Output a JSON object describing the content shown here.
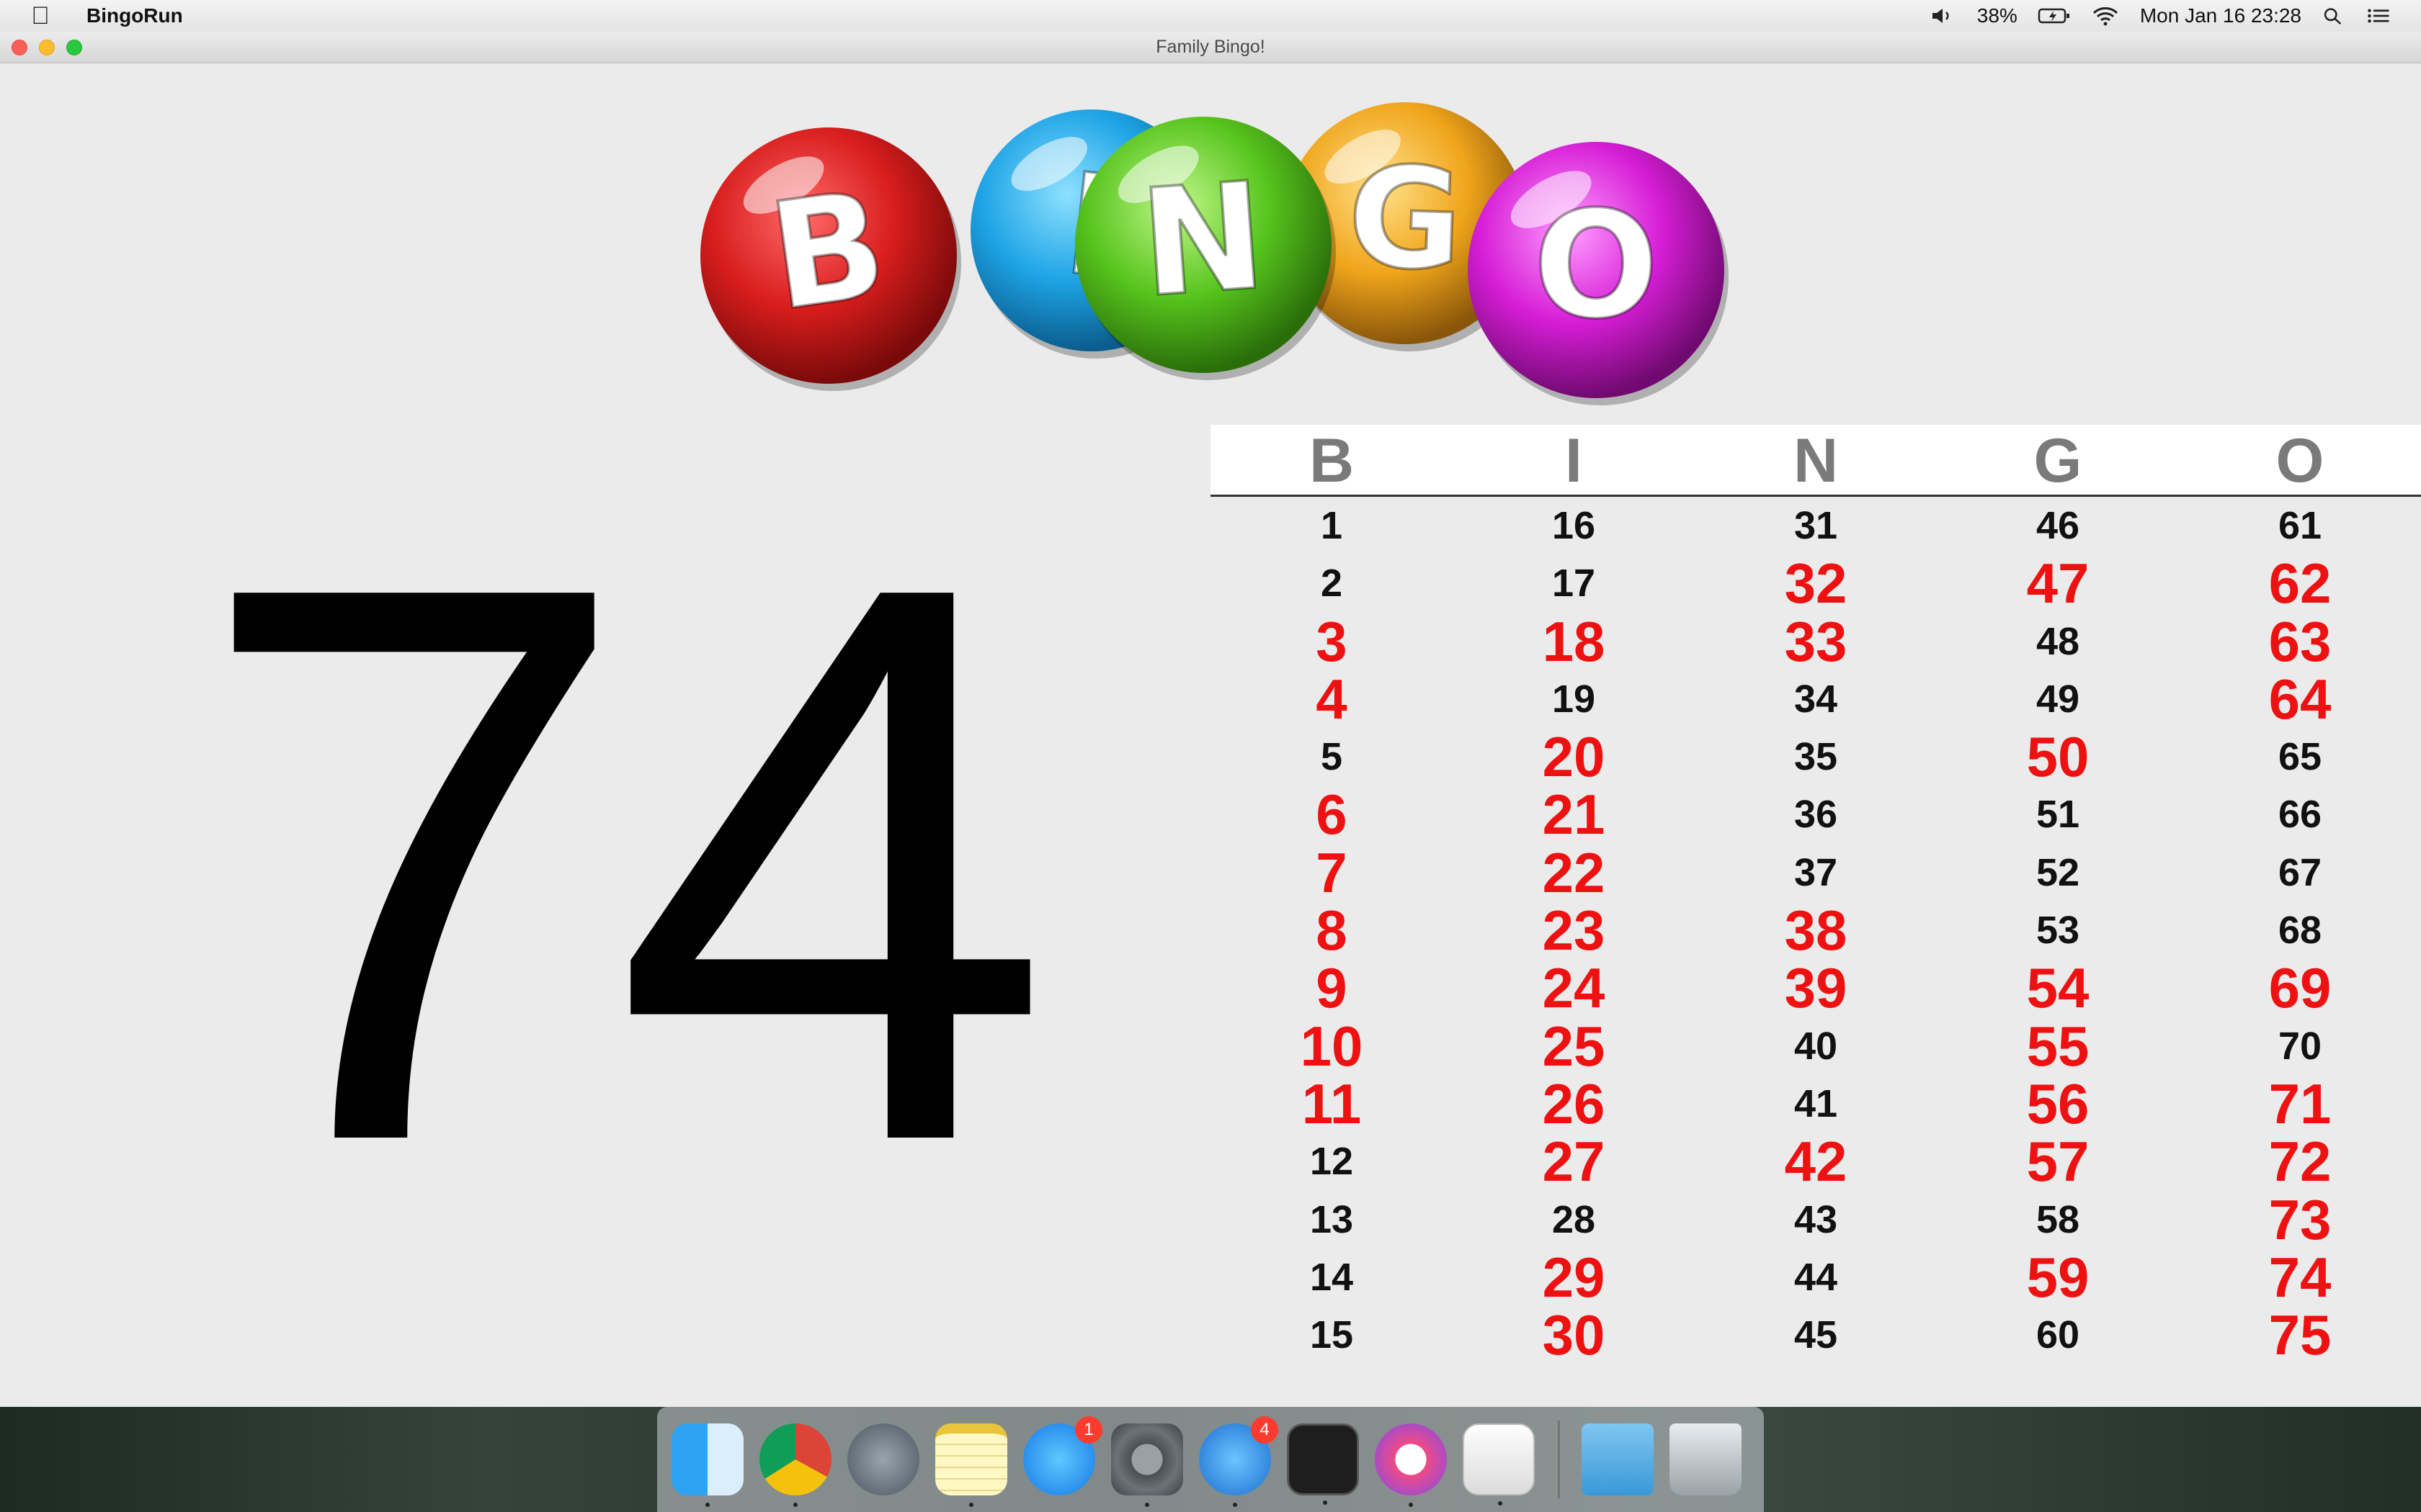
{
  "menubar": {
    "app_name": "BingoRun",
    "battery": "38%",
    "datetime": "Mon Jan 16  23:28"
  },
  "window": {
    "title": "Family Bingo!"
  },
  "logo": {
    "letters": [
      "B",
      "I",
      "N",
      "G",
      "O"
    ],
    "colors": [
      "#d81d1d",
      "#1ea4e6",
      "#57c41d",
      "#f0a51b",
      "#d61dd6"
    ]
  },
  "current_number": "74",
  "board": {
    "headers": [
      "B",
      "I",
      "N",
      "G",
      "O"
    ],
    "columns": [
      {
        "numbers": [
          1,
          2,
          3,
          4,
          5,
          6,
          7,
          8,
          9,
          10,
          11,
          12,
          13,
          14,
          15
        ],
        "called": [
          3,
          4,
          6,
          7,
          8,
          9,
          10,
          11
        ]
      },
      {
        "numbers": [
          16,
          17,
          18,
          19,
          20,
          21,
          22,
          23,
          24,
          25,
          26,
          27,
          28,
          29,
          30
        ],
        "called": [
          18,
          20,
          21,
          22,
          23,
          24,
          25,
          26,
          27,
          29,
          30
        ]
      },
      {
        "numbers": [
          31,
          32,
          33,
          34,
          35,
          36,
          37,
          38,
          39,
          40,
          41,
          42,
          43,
          44,
          45
        ],
        "called": [
          32,
          33,
          38,
          39,
          42
        ]
      },
      {
        "numbers": [
          46,
          47,
          48,
          49,
          50,
          51,
          52,
          53,
          54,
          55,
          56,
          57,
          58,
          59,
          60
        ],
        "called": [
          47,
          50,
          54,
          55,
          56,
          57,
          59
        ]
      },
      {
        "numbers": [
          61,
          62,
          63,
          64,
          65,
          66,
          67,
          68,
          69,
          70,
          71,
          72,
          73,
          74,
          75
        ],
        "called": [
          62,
          63,
          64,
          69,
          71,
          72,
          73,
          74,
          75
        ]
      }
    ],
    "called_color": "#ee1111"
  },
  "dock": {
    "items": [
      {
        "name": "finder-icon",
        "running": true
      },
      {
        "name": "chrome-icon",
        "running": true
      },
      {
        "name": "launchpad-icon",
        "running": false
      },
      {
        "name": "notes-icon",
        "running": true
      },
      {
        "name": "app-store-icon",
        "running": false,
        "badge": "1"
      },
      {
        "name": "system-preferences-icon",
        "running": true
      },
      {
        "name": "mustache-app-icon",
        "running": true,
        "badge": "4"
      },
      {
        "name": "terminal-icon",
        "running": true
      },
      {
        "name": "itunes-icon",
        "running": true
      },
      {
        "name": "java-icon",
        "running": true
      }
    ],
    "right_items": [
      {
        "name": "downloads-folder-icon"
      },
      {
        "name": "trash-icon"
      }
    ]
  }
}
